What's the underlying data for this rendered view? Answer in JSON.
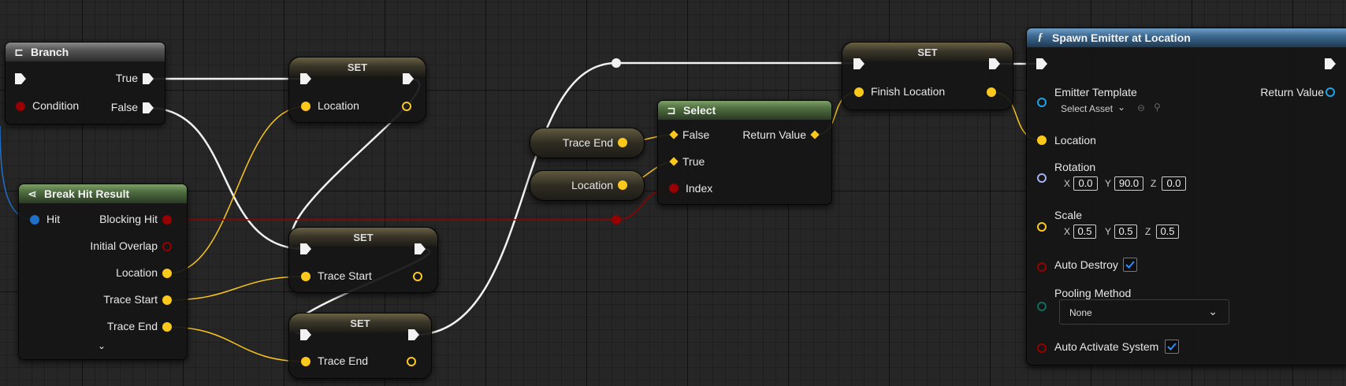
{
  "colors": {
    "exec": "#f2f2f2",
    "bool": "#960000",
    "vector": "#fdc81c",
    "struct": "#1f6fc7",
    "object": "#1fa3e6",
    "rotator": "#a5b1f4",
    "enum": "#0f6b5c"
  },
  "branch": {
    "title": "Branch",
    "icon": "branch-icon",
    "true_label": "True",
    "false_label": "False",
    "condition_label": "Condition"
  },
  "break_hit": {
    "title": "Break Hit Result",
    "icon": "break-struct-icon",
    "hit_label": "Hit",
    "blocking_hit": "Blocking Hit",
    "initial_overlap": "Initial Overlap",
    "location": "Location",
    "trace_start": "Trace Start",
    "trace_end": "Trace End",
    "expand_icon": "chevron-down-icon"
  },
  "set_location": {
    "title": "SET",
    "pin": "Location"
  },
  "set_trace_start": {
    "title": "SET",
    "pin": "Trace Start"
  },
  "set_trace_end": {
    "title": "SET",
    "pin": "Trace End"
  },
  "get_trace_end": {
    "label": "Trace End"
  },
  "get_location": {
    "label": "Location"
  },
  "select": {
    "title": "Select",
    "icon": "select-icon",
    "false_label": "False",
    "true_label": "True",
    "index_label": "Index",
    "return_label": "Return Value"
  },
  "set_finish": {
    "title": "SET",
    "pin": "Finish Location"
  },
  "spawn": {
    "title": "Spawn Emitter at Location",
    "icon": "function-icon",
    "emitter_template": "Emitter Template",
    "select_asset": "Select Asset",
    "return_value": "Return Value",
    "location": "Location",
    "rotation": "Rotation",
    "rotation_values": {
      "x": "0.0",
      "y": "90.0",
      "z": "0.0"
    },
    "scale": "Scale",
    "scale_values": {
      "x": "0.5",
      "y": "0.5",
      "z": "0.5"
    },
    "axis_x": "X",
    "axis_y": "Y",
    "axis_z": "Z",
    "auto_destroy": "Auto Destroy",
    "auto_destroy_checked": true,
    "pooling_method": "Pooling Method",
    "pooling_value": "None",
    "auto_activate": "Auto Activate System",
    "auto_activate_checked": true
  }
}
